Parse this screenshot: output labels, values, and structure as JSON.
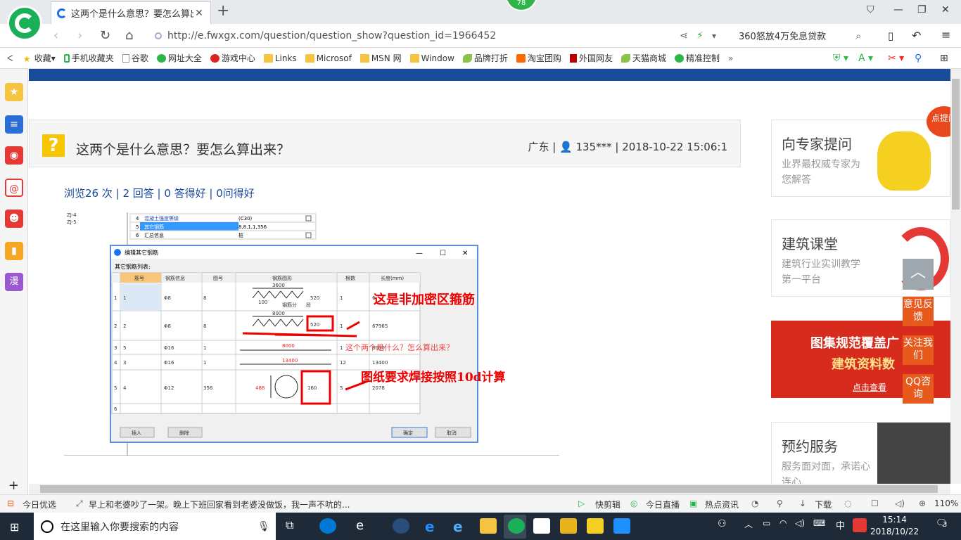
{
  "browser": {
    "tab_title": "这两个是什么意思？要怎么算出来",
    "new_tab": "+",
    "badge": "78",
    "url": "http://e.fwxgx.com/question/question_show?question_id=1966452",
    "ad_text": "360怒放4万免息贷款"
  },
  "bookmarks": [
    {
      "label": "收藏",
      "icon": "star-icon"
    },
    {
      "label": "手机收藏夹",
      "icon": "phone-icon"
    },
    {
      "label": "谷歌",
      "icon": "page-icon"
    },
    {
      "label": "网址大全",
      "icon": "globe-icon"
    },
    {
      "label": "游戏中心",
      "icon": "game-icon"
    },
    {
      "label": "Links",
      "icon": "folder-icon"
    },
    {
      "label": "Microsof",
      "icon": "folder-icon"
    },
    {
      "label": "MSN 网",
      "icon": "folder-icon"
    },
    {
      "label": "Window",
      "icon": "folder-icon"
    },
    {
      "label": "品牌打折",
      "icon": "leaf-icon"
    },
    {
      "label": "淘宝团购",
      "icon": "taobao-icon"
    },
    {
      "label": "外国网友",
      "icon": "bookmark-icon"
    },
    {
      "label": "天猫商城",
      "icon": "leaf-icon"
    },
    {
      "label": "精准控制",
      "icon": "chat-icon"
    }
  ],
  "question": {
    "title": "这两个是什么意思？要怎么算出来？",
    "meta": "广东 | 👤 135*** | 2018-10-22 15:06:1",
    "stats": "浏览26 次 | 2 回答 | 0 答得好 | 0问得好"
  },
  "screenshot": {
    "left_labels": [
      "ZJ-4",
      "ZJ-5"
    ],
    "prop_rows": [
      {
        "no": "4",
        "name": "混凝土强度等级",
        "value": "(C30)"
      },
      {
        "no": "5",
        "name": "其它钢筋",
        "value": "8,8,1,1,356"
      },
      {
        "no": "6",
        "name": "汇总信息",
        "value": "桩"
      }
    ],
    "dialog_title": "编辑其它钢筋",
    "list_label": "其它钢筋列表:",
    "headers": [
      "筋号",
      "钢筋信息",
      "图号",
      "钢筋图形",
      "根数",
      "长度(mm)"
    ],
    "rows": [
      {
        "idx": "1",
        "no": "1",
        "info": "Φ8",
        "fig": "8",
        "count": "1",
        "len": "6"
      },
      {
        "idx": "2",
        "no": "2",
        "info": "Φ8",
        "fig": "8",
        "count": "1",
        "len": "67965"
      },
      {
        "idx": "3",
        "no": "5",
        "info": "Φ16",
        "fig": "1",
        "count": "1",
        "len": "8000"
      },
      {
        "idx": "4",
        "no": "3",
        "info": "Φ16",
        "fig": "1",
        "count": "12",
        "len": "13400"
      },
      {
        "idx": "5",
        "no": "4",
        "info": "Φ12",
        "fig": "356",
        "count": "5",
        "len": "2078"
      },
      {
        "idx": "6",
        "no": "",
        "info": "",
        "fig": "",
        "count": "",
        "len": ""
      }
    ],
    "shape_labels": [
      "3600",
      "520",
      "100",
      "钢筋分",
      "段",
      "8000",
      "520",
      "8000",
      "13400",
      "488",
      "160"
    ],
    "buttons": [
      "插入",
      "删除",
      "确定",
      "取消"
    ],
    "annotations": [
      "这是非加密区箍筋",
      "这个两个是什么？怎么算出来？",
      "图纸要求焊接按照10d计算"
    ]
  },
  "sidebar_ads": [
    {
      "title": "向专家提问",
      "sub": "业界最权威专家为您解答",
      "bubble": "点提问"
    },
    {
      "title": "建筑课堂",
      "sub": "建筑行业实训教学第一平台"
    },
    {
      "title": "图集规范覆盖广",
      "sub": "建筑资料数",
      "cta": "点击查看"
    },
    {
      "title": "预约服务",
      "sub": "服务面对面，承诺心连心"
    }
  ],
  "float_buttons": [
    "意见反馈",
    "关注我们",
    "QQ咨询"
  ],
  "statusbar": {
    "left": "今日优选",
    "news": "早上和老婆吵了一架。晚上下班回家看到老婆没做饭，我一声不吭的...",
    "items": [
      "快剪辑",
      "今日直播",
      "热点资讯",
      "下载"
    ],
    "zoom": "110%"
  },
  "taskbar": {
    "search_placeholder": "在这里输入你要搜索的内容",
    "time": "15:14",
    "date": "2018/10/22",
    "lang": "中",
    "notif": "3"
  },
  "colors": {
    "brand_blue": "#1a4a9b",
    "accent_orange": "#e85a1c",
    "logo_green": "#1ab05a"
  }
}
